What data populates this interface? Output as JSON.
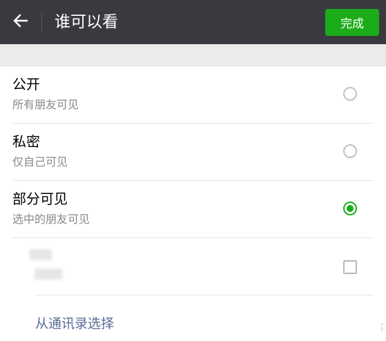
{
  "header": {
    "title": "谁可以看",
    "done_label": "完成",
    "back_icon": "arrow-left-icon"
  },
  "options": [
    {
      "label": "公开",
      "description": "所有朋友可见",
      "selected": false
    },
    {
      "label": "私密",
      "description": "仅自己可见",
      "selected": false
    },
    {
      "label": "部分可见",
      "description": "选中的朋友可见",
      "selected": true
    }
  ],
  "group": {
    "checked": false
  },
  "link": {
    "select_from_contacts": "从通讯录选择"
  },
  "colors": {
    "topbar": "#393a3f",
    "accent_green": "#1aad19",
    "link_blue": "#576b95",
    "secondary_text": "#888888"
  }
}
